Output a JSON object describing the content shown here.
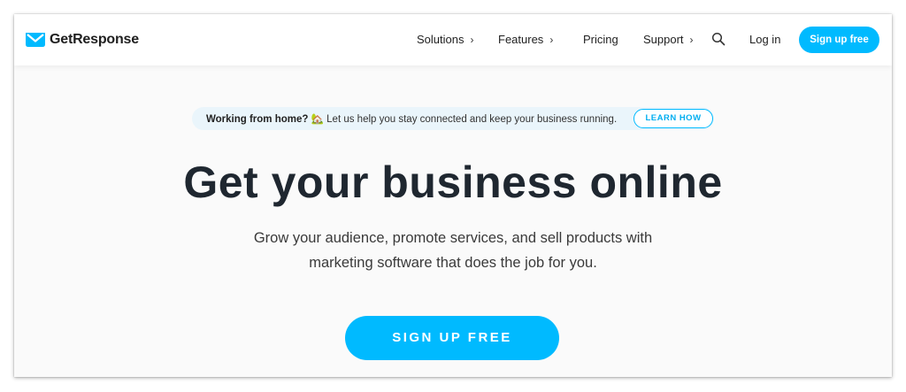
{
  "brand": {
    "name": "GetResponse",
    "logo_icon": "envelope-check-icon",
    "accent_color": "#00baff",
    "text_color": "#1f2730"
  },
  "nav": {
    "solutions": "Solutions",
    "features": "Features",
    "pricing": "Pricing",
    "support": "Support",
    "chevron": "›",
    "search_icon": "search-icon",
    "login": "Log in",
    "signup": "Sign up free"
  },
  "banner": {
    "lead": "Working from home?",
    "emoji": "🏡",
    "text": " Let us help you stay connected and keep your business running.",
    "button": "LEARN HOW"
  },
  "hero": {
    "headline": "Get your business online",
    "subline_1": "Grow your audience, promote services, and sell products with",
    "subline_2": "marketing software that does the job for you.",
    "cta": "SIGN UP FREE"
  }
}
